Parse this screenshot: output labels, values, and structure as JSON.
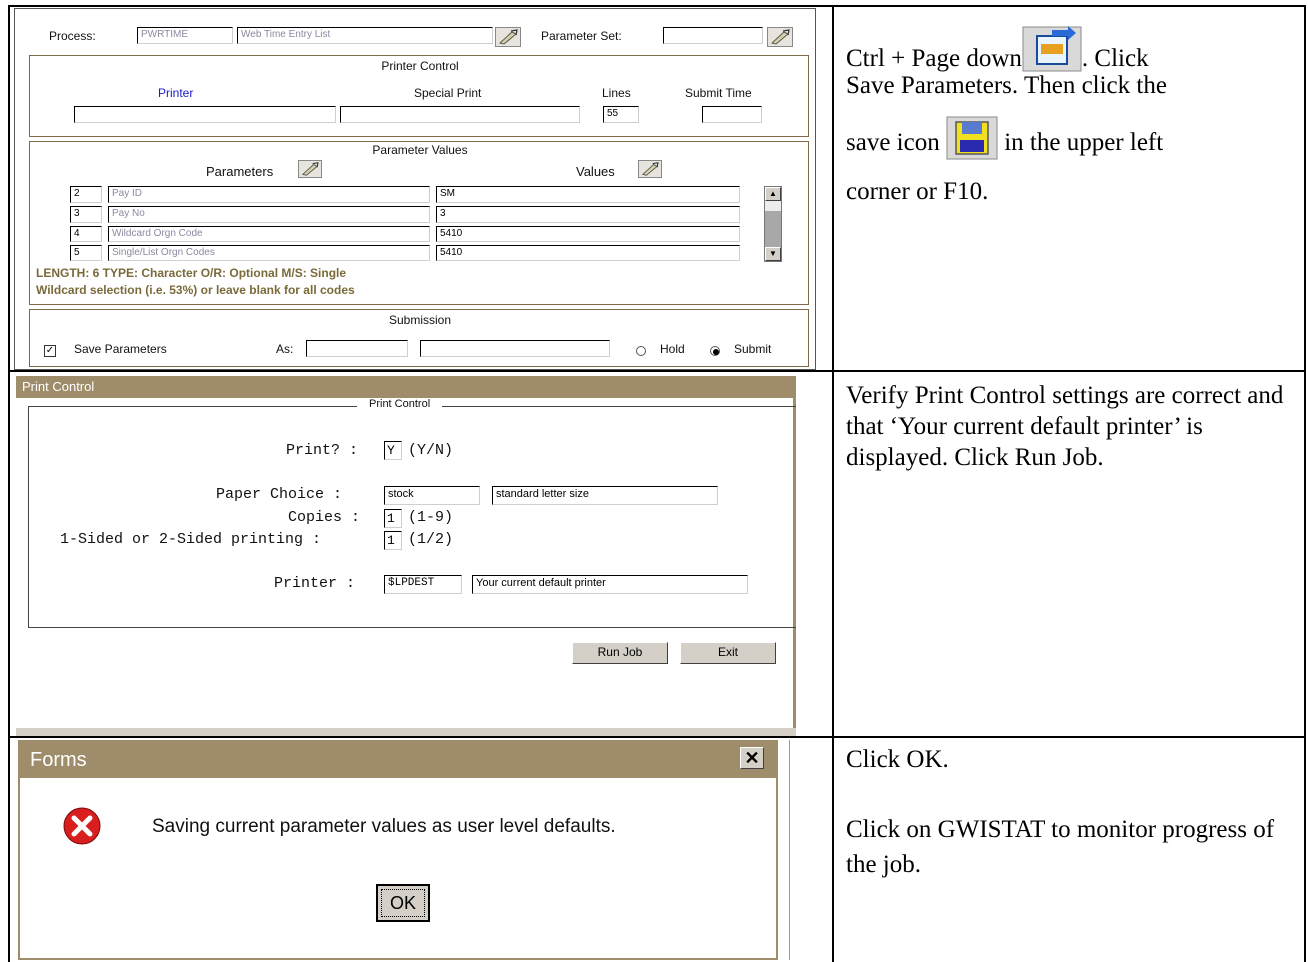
{
  "row1": {
    "process_label": "Process:",
    "process_code": "PWRTIME",
    "process_name": "Web Time Entry List",
    "parameter_set_label": "Parameter Set:",
    "printer_control": {
      "title": "Printer Control",
      "printer_label": "Printer",
      "special_print_label": "Special Print",
      "lines_label": "Lines",
      "submit_time_label": "Submit Time",
      "lines_value": "55"
    },
    "parameter_values": {
      "title": "Parameter Values",
      "parameters_label": "Parameters",
      "values_label": "Values",
      "rows": [
        {
          "num": "2",
          "name": "Pay ID",
          "value": "SM"
        },
        {
          "num": "3",
          "name": "Pay No",
          "value": "3"
        },
        {
          "num": "4",
          "name": "Wildcard Orgn Code",
          "value": "5410"
        },
        {
          "num": "5",
          "name": "Single/List Orgn Codes",
          "value": "5410"
        }
      ],
      "hint1": "LENGTH: 6 TYPE: Character O/R: Optional M/S: Single",
      "hint2": "Wildcard selection (i.e. 53%) or leave blank for all codes"
    },
    "submission": {
      "title": "Submission",
      "save_parameters_label": "Save Parameters",
      "save_parameters_checked": true,
      "as_label": "As:",
      "hold_label": "Hold",
      "submit_label": "Submit",
      "selected": "Submit"
    },
    "instruction": {
      "line1_a": "Ctrl + Page down",
      "line1_b": ". Click",
      "line2": "Save Parameters. Then click the",
      "line3_a": "save icon",
      "line3_b": "in the upper left",
      "line4": "corner or F10."
    }
  },
  "row2": {
    "window_title": "Print Control",
    "group_title": "Print Control",
    "print_label": "Print? :",
    "print_value": "Y",
    "print_hint": "(Y/N)",
    "paper_choice_label": "Paper Choice :",
    "paper_code": "stock",
    "paper_desc": "standard letter size",
    "copies_label": "Copies :",
    "copies_value": "1",
    "copies_hint": "(1-9)",
    "sided_label": "1-Sided or 2-Sided printing :",
    "sided_value": "1",
    "sided_hint": "(1/2)",
    "printer_label": "Printer :",
    "printer_code": "$LPDEST",
    "printer_desc": "Your current default printer",
    "run_job_label": "Run Job",
    "exit_label": "Exit",
    "instruction": "Verify Print Control settings are correct and that ‘Your current default printer’ is displayed. Click Run Job."
  },
  "row3": {
    "dialog_title": "Forms",
    "message": "Saving current parameter values as user level defaults.",
    "ok_label": "OK",
    "instruction1": "Click OK.",
    "instruction2": "Click on GWISTAT to monitor progress of the job."
  },
  "colors": {
    "title_bar": "#9e8c6a",
    "panel_border": "#7c6a4a",
    "printer_label_color": "#1a1acc",
    "hint_color": "#7a6a3a",
    "error_icon": "#d81e1e"
  },
  "icons": [
    "next-block-icon",
    "save-icon",
    "search-icon",
    "close-icon",
    "error-icon",
    "checkbox-icon",
    "radio-icon",
    "scroll-up-icon",
    "scroll-down-icon"
  ]
}
